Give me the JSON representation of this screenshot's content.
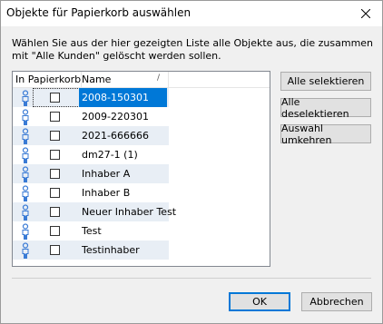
{
  "window": {
    "title": "Objekte für Papierkorb auswählen"
  },
  "description": "Wählen Sie aus der hier gezeigten Liste alle Objekte aus, die zusammen mit \"Alle Kunden\" gelöscht werden sollen.",
  "list": {
    "columns": [
      "In Papierkorb",
      "Name"
    ],
    "sort_indicator": "/",
    "rows": [
      {
        "name": "2008-150301",
        "checked": false,
        "selected": true
      },
      {
        "name": "2009-220301",
        "checked": false,
        "selected": false
      },
      {
        "name": "2021-666666",
        "checked": false,
        "selected": false
      },
      {
        "name": "dm27-1 (1)",
        "checked": false,
        "selected": false
      },
      {
        "name": "Inhaber A",
        "checked": false,
        "selected": false
      },
      {
        "name": "Inhaber B",
        "checked": false,
        "selected": false
      },
      {
        "name": "Neuer Inhaber Test",
        "checked": false,
        "selected": false
      },
      {
        "name": "Test",
        "checked": false,
        "selected": false
      },
      {
        "name": "Testinhaber",
        "checked": false,
        "selected": false
      }
    ]
  },
  "side_buttons": {
    "select_all": "Alle selektieren",
    "deselect_all": "Alle deselektieren",
    "invert": "Auswahl umkehren"
  },
  "footer": {
    "ok": "OK",
    "cancel": "Abbrechen"
  },
  "colors": {
    "selection": "#0078d7",
    "alt_row": "#e8eef5",
    "person_icon": "#3a7bd5"
  },
  "icons": {
    "row_icon": "person-icon",
    "close": "close-icon"
  }
}
